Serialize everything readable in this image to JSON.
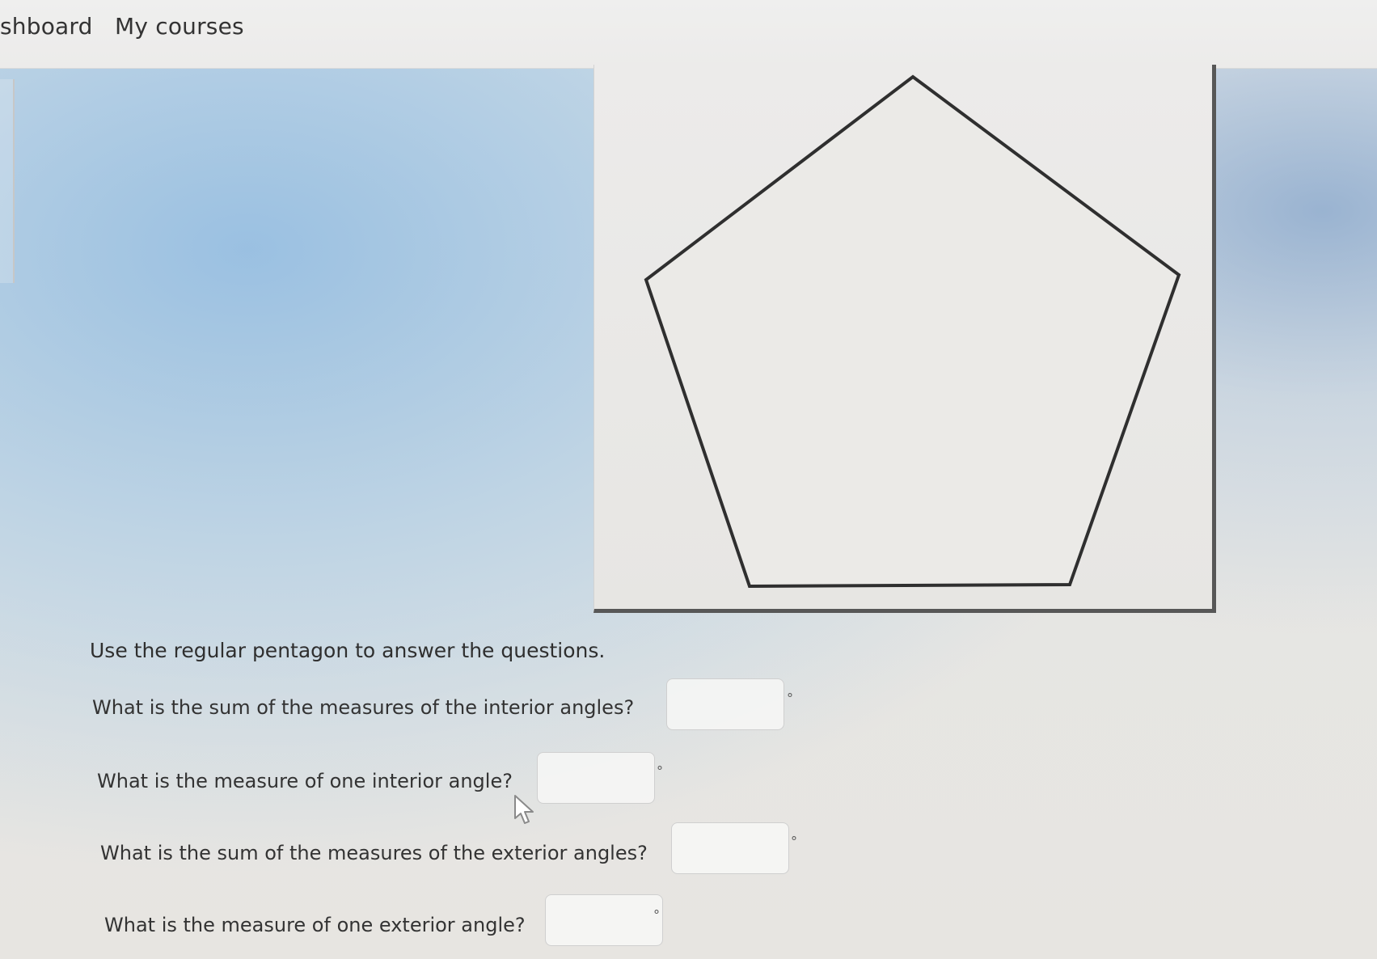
{
  "nav": {
    "items": [
      {
        "label": "shboard"
      },
      {
        "label": "My courses"
      }
    ]
  },
  "figure": {
    "shape": "regular pentagon",
    "stroke_color": "#2f2f2f",
    "fill_color": "#ebeae7"
  },
  "instructions": "Use the regular pentagon to answer the questions.",
  "questions": [
    {
      "text": "What is the sum of the measures of the interior angles?",
      "answer_value": "",
      "unit": "°"
    },
    {
      "text": "What is the measure of one interior angle?",
      "answer_value": "",
      "unit": "°"
    },
    {
      "text": "What is the sum of the measures of the exterior angles?",
      "answer_value": "",
      "unit": "°"
    },
    {
      "text": "What is the measure of one exterior angle?",
      "answer_value": "",
      "unit": "°"
    }
  ],
  "icons": {
    "cursor": "mouse-pointer-icon"
  }
}
